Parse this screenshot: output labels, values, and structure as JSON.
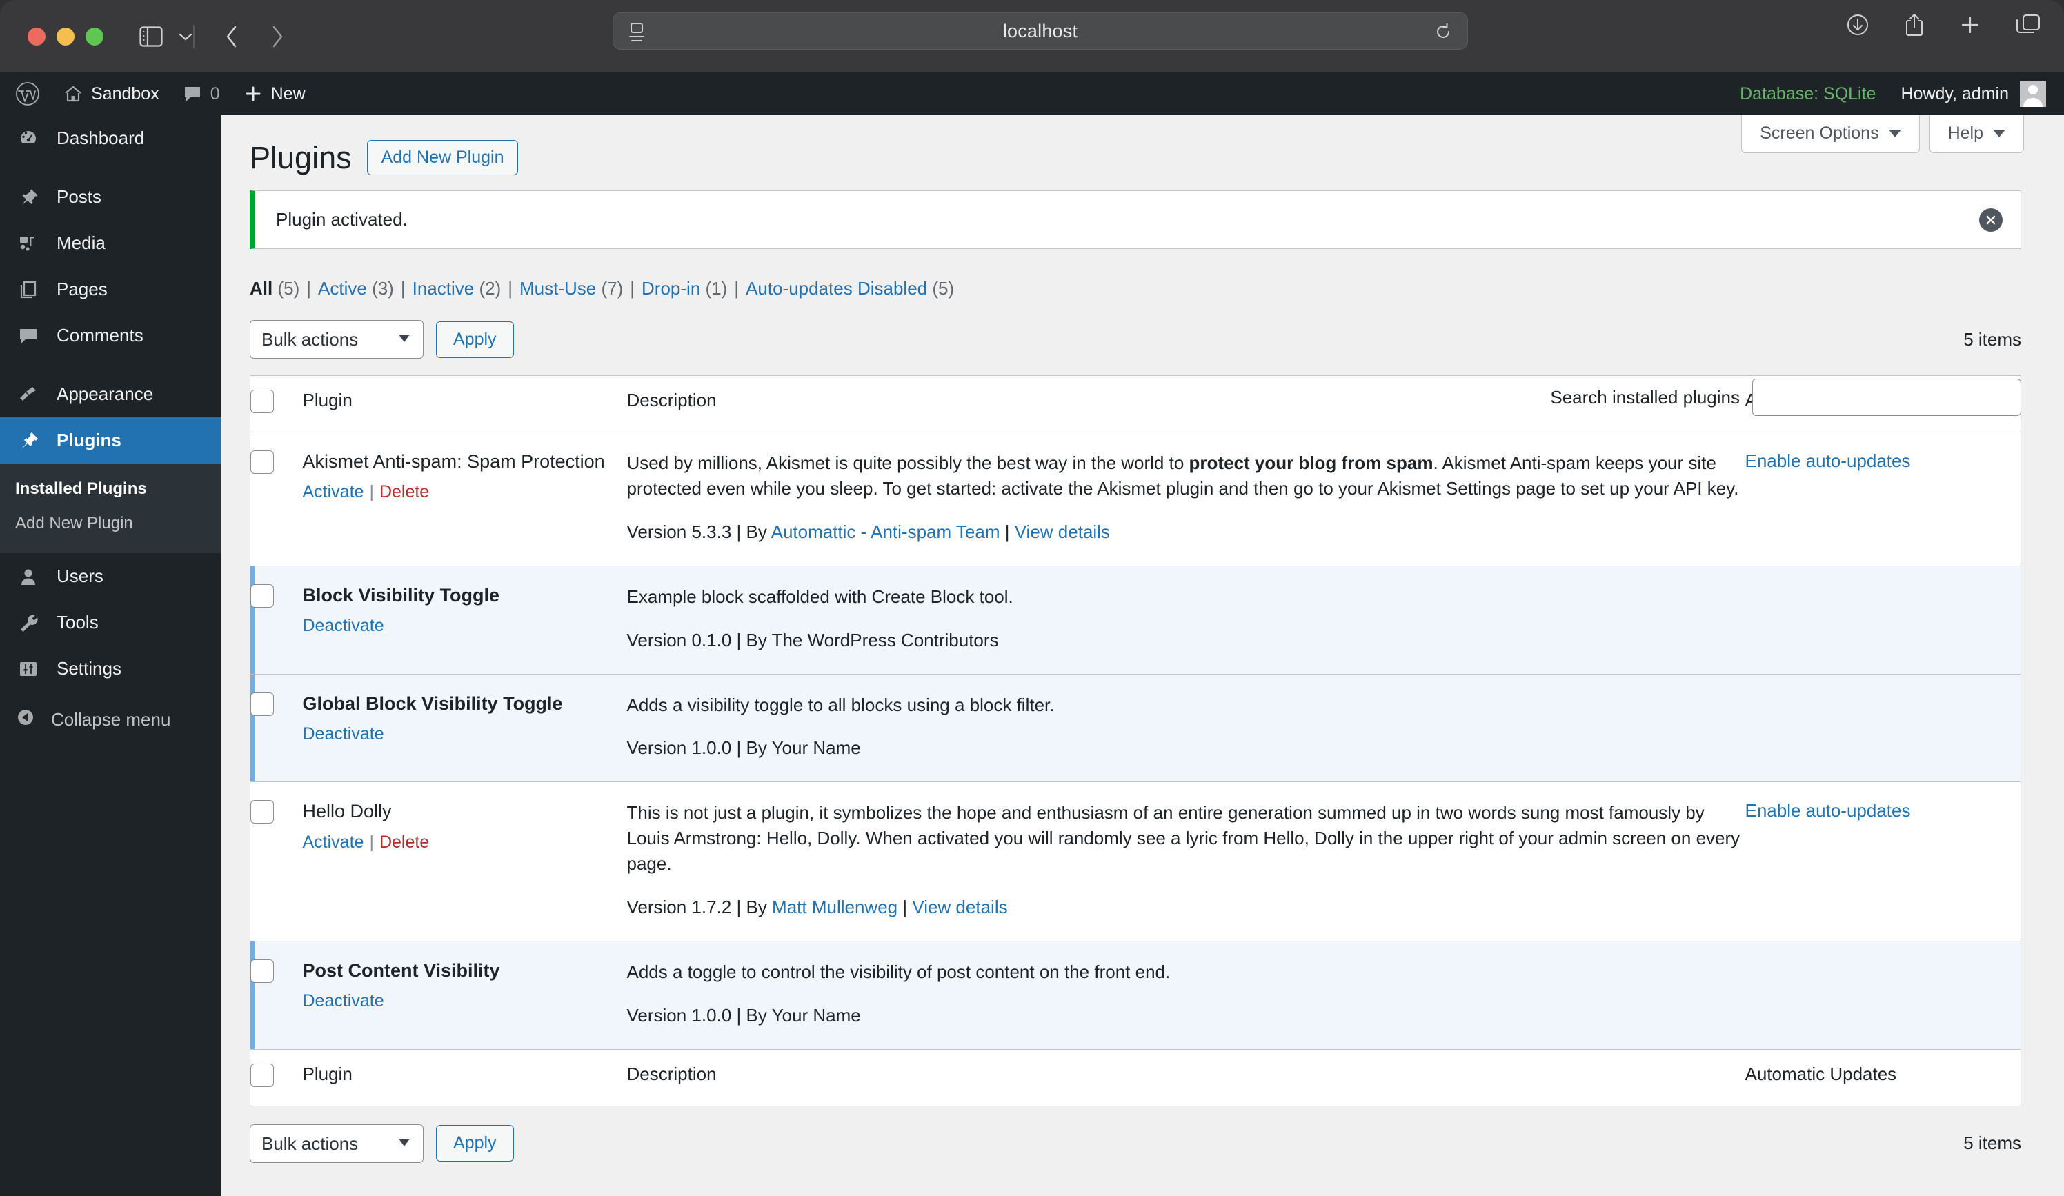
{
  "browser": {
    "url": "localhost",
    "icons": {
      "sidebar": "sidebar-toggle-icon",
      "sidebar_chevron": "chevron-down-icon",
      "back": "back-chevron-icon",
      "forward": "forward-chevron-icon",
      "reader": "reader-view-icon",
      "reload": "reload-icon",
      "downloads": "downloads-icon",
      "share": "share-icon",
      "new_tab": "plus-icon",
      "tab_overview": "tab-overview-icon"
    }
  },
  "adminbar": {
    "wp_logo": "wordpress-logo-icon",
    "site_name": "Sandbox",
    "home_icon": "home-icon",
    "comments_icon": "comment-bubble-icon",
    "comment_count": "0",
    "new_icon": "plus-icon",
    "new_label": "New",
    "database": "Database: SQLite",
    "database_color": "#68b468",
    "howdy": "Howdy, admin",
    "avatar": "user-avatar-icon"
  },
  "sidebar": {
    "items": [
      {
        "label": "Dashboard",
        "icon": "dashboard-icon",
        "current": false
      },
      {
        "label": "Posts",
        "icon": "pin-icon",
        "current": false
      },
      {
        "label": "Media",
        "icon": "media-icon",
        "current": false
      },
      {
        "label": "Pages",
        "icon": "pages-icon",
        "current": false
      },
      {
        "label": "Comments",
        "icon": "comment-bubble-icon",
        "current": false
      },
      {
        "label": "Appearance",
        "icon": "paintbrush-icon",
        "current": false
      },
      {
        "label": "Plugins",
        "icon": "plug-icon",
        "current": true
      },
      {
        "label": "Users",
        "icon": "user-icon",
        "current": false
      },
      {
        "label": "Tools",
        "icon": "wrench-icon",
        "current": false
      },
      {
        "label": "Settings",
        "icon": "sliders-icon",
        "current": false
      }
    ],
    "submenu": [
      {
        "label": "Installed Plugins",
        "current": true
      },
      {
        "label": "Add New Plugin",
        "current": false
      }
    ],
    "collapse": {
      "label": "Collapse menu",
      "icon": "collapse-left-icon"
    },
    "accent_color": "#2271b1"
  },
  "screen_meta": {
    "screen_options": "Screen Options",
    "help": "Help"
  },
  "page": {
    "title": "Plugins",
    "add_new_button": "Add New Plugin",
    "notice": "Plugin activated.",
    "notice_dismiss_icon": "close-circle-icon",
    "notice_accent": "#00a32a"
  },
  "filters": [
    {
      "label": "All",
      "count": "(5)",
      "current": true
    },
    {
      "label": "Active",
      "count": "(3)",
      "current": false
    },
    {
      "label": "Inactive",
      "count": "(2)",
      "current": false
    },
    {
      "label": "Must-Use",
      "count": "(7)",
      "current": false
    },
    {
      "label": "Drop-in",
      "count": "(1)",
      "current": false
    },
    {
      "label": "Auto-updates Disabled",
      "count": "(5)",
      "current": false
    }
  ],
  "search": {
    "label": "Search installed plugins",
    "value": "",
    "placeholder": ""
  },
  "tablenav_top": {
    "bulk_label": "Bulk actions",
    "apply_label": "Apply",
    "items": "5 items"
  },
  "tablenav_bottom": {
    "bulk_label": "Bulk actions",
    "apply_label": "Apply",
    "items": "5 items"
  },
  "table": {
    "columns": {
      "plugin": "Plugin",
      "description": "Description",
      "auto_updates": "Automatic Updates"
    },
    "rows": [
      {
        "name": "Akismet Anti-spam: Spam Protection",
        "state": "inactive",
        "actions": [
          {
            "label": "Activate",
            "kind": "activate"
          },
          {
            "label": "Delete",
            "kind": "delete"
          }
        ],
        "description_pre": "Used by millions, Akismet is quite possibly the best way in the world to ",
        "description_bold": "protect your blog from spam",
        "description_post": ". Akismet Anti-spam keeps your site protected even while you sleep. To get started: activate the Akismet plugin and then go to your Akismet Settings page to set up your API key.",
        "version": "Version 5.3.3 | By ",
        "author": "Automattic - Anti-spam Team",
        "view_details": "View details",
        "auto_update": "Enable auto-updates"
      },
      {
        "name": "Block Visibility Toggle",
        "state": "active",
        "actions": [
          {
            "label": "Deactivate",
            "kind": "deactivate"
          }
        ],
        "description_pre": "Example block scaffolded with Create Block tool.",
        "description_bold": "",
        "description_post": "",
        "version": "Version 0.1.0 | By The WordPress Contributors",
        "author": "",
        "view_details": "",
        "auto_update": ""
      },
      {
        "name": "Global Block Visibility Toggle",
        "state": "active",
        "actions": [
          {
            "label": "Deactivate",
            "kind": "deactivate"
          }
        ],
        "description_pre": "Adds a visibility toggle to all blocks using a block filter.",
        "description_bold": "",
        "description_post": "",
        "version": "Version 1.0.0 | By Your Name",
        "author": "",
        "view_details": "",
        "auto_update": ""
      },
      {
        "name": "Hello Dolly",
        "state": "inactive",
        "actions": [
          {
            "label": "Activate",
            "kind": "activate"
          },
          {
            "label": "Delete",
            "kind": "delete"
          }
        ],
        "description_pre": "This is not just a plugin, it symbolizes the hope and enthusiasm of an entire generation summed up in two words sung most famously by Louis Armstrong: Hello, Dolly. When activated you will randomly see a lyric from Hello, Dolly in the upper right of your admin screen on every page.",
        "description_bold": "",
        "description_post": "",
        "version": "Version 1.7.2 | By ",
        "author": "Matt Mullenweg",
        "view_details": "View details",
        "auto_update": "Enable auto-updates"
      },
      {
        "name": "Post Content Visibility",
        "state": "active",
        "actions": [
          {
            "label": "Deactivate",
            "kind": "deactivate"
          }
        ],
        "description_pre": "Adds a toggle to control the visibility of post content on the front end.",
        "description_bold": "",
        "description_post": "",
        "version": "Version 1.0.0 | By Your Name",
        "author": "",
        "view_details": "",
        "auto_update": ""
      }
    ]
  }
}
